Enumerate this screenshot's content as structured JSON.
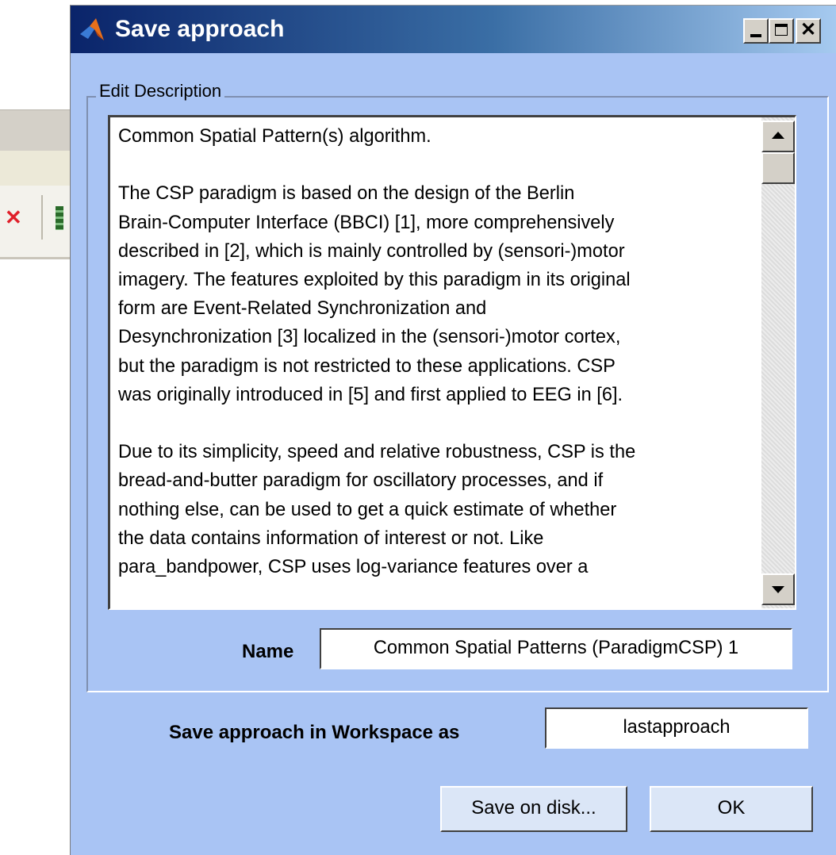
{
  "dialog": {
    "title": "Save approach",
    "title_icon": "matlab-icon",
    "window_controls": [
      "minimize-icon",
      "maximize-icon",
      "close-icon"
    ]
  },
  "group": {
    "legend": "Edit Description",
    "description": "Common Spatial Pattern(s) algorithm.\n\nThe CSP paradigm is based on the design of the Berlin\nBrain-Computer Interface (BBCI) [1], more comprehensively\ndescribed in [2], which is mainly controlled by (sensori-)motor\nimagery. The features exploited by this paradigm in its original\nform are Event-Related Synchronization and\nDesynchronization [3] localized in the (sensori-)motor cortex,\nbut the paradigm is not restricted to these applications. CSP\nwas originally introduced in [5] and first applied to EEG in [6].\n\nDue to its simplicity, speed and relative robustness, CSP is the\nbread-and-butter paradigm for oscillatory processes, and if\nnothing else, can be used to get a quick estimate of whether\nthe data contains information of interest or not. Like\npara_bandpower, CSP uses log-variance features over a",
    "name_label": "Name",
    "name_value": "Common Spatial Patterns (ParadigmCSP) 1"
  },
  "workspace": {
    "label": "Save approach in Workspace as",
    "value": "lastapproach"
  },
  "buttons": {
    "save_on_disk": "Save on disk...",
    "ok": "OK"
  },
  "colors": {
    "dialog_bg": "#a9c4f4",
    "titlebar_start": "#0a246a",
    "titlebar_end": "#a6caf0"
  }
}
